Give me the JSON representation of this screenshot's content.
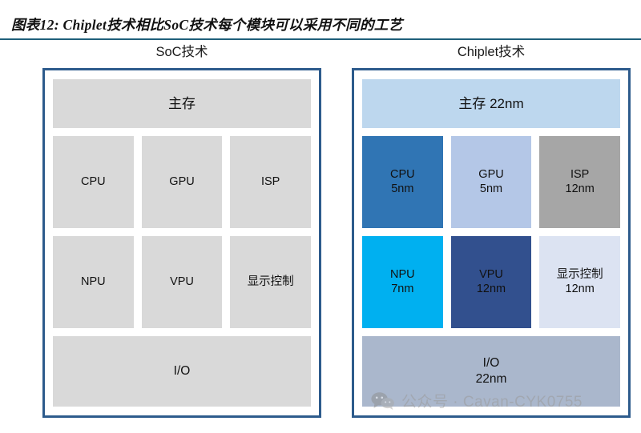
{
  "figure": {
    "title": "图表12: Chiplet技术相比SoC技术每个模块可以采用不同的工艺",
    "rule_color": "#1f5f7a",
    "panel_border_color": "#2d5b8c"
  },
  "panels": [
    {
      "id": "soc",
      "heading": "SoC技术",
      "rows": [
        {
          "id": "memory-row",
          "blocks": [
            {
              "name": "main-memory",
              "label": "主存",
              "sublabel": "",
              "color": "#d9d9d9"
            }
          ]
        },
        {
          "id": "compute-row-1",
          "blocks": [
            {
              "name": "cpu",
              "label": "CPU",
              "sublabel": "",
              "color": "#d9d9d9"
            },
            {
              "name": "gpu",
              "label": "GPU",
              "sublabel": "",
              "color": "#d9d9d9"
            },
            {
              "name": "isp",
              "label": "ISP",
              "sublabel": "",
              "color": "#d9d9d9"
            }
          ]
        },
        {
          "id": "compute-row-2",
          "blocks": [
            {
              "name": "npu",
              "label": "NPU",
              "sublabel": "",
              "color": "#d9d9d9"
            },
            {
              "name": "vpu",
              "label": "VPU",
              "sublabel": "",
              "color": "#d9d9d9"
            },
            {
              "name": "display-controller",
              "label": "显示控制",
              "sublabel": "",
              "color": "#d9d9d9"
            }
          ]
        },
        {
          "id": "io-row",
          "blocks": [
            {
              "name": "io",
              "label": "I/O",
              "sublabel": "",
              "color": "#d9d9d9"
            }
          ]
        }
      ]
    },
    {
      "id": "chiplet",
      "heading": "Chiplet技术",
      "rows": [
        {
          "id": "memory-row",
          "blocks": [
            {
              "name": "main-memory",
              "label": "主存 22nm",
              "sublabel": "",
              "color": "#bdd7ee"
            }
          ]
        },
        {
          "id": "compute-row-1",
          "blocks": [
            {
              "name": "cpu",
              "label": "CPU",
              "sublabel": "5nm",
              "color": "#3075b4"
            },
            {
              "name": "gpu",
              "label": "GPU",
              "sublabel": "5nm",
              "color": "#b4c7e7"
            },
            {
              "name": "isp",
              "label": "ISP",
              "sublabel": "12nm",
              "color": "#a6a6a6"
            }
          ]
        },
        {
          "id": "compute-row-2",
          "blocks": [
            {
              "name": "npu",
              "label": "NPU",
              "sublabel": "7nm",
              "color": "#00b0f0"
            },
            {
              "name": "vpu",
              "label": "VPU",
              "sublabel": "12nm",
              "color": "#32508e"
            },
            {
              "name": "display-controller",
              "label": "显示控制",
              "sublabel": "12nm",
              "color": "#dce3f2"
            }
          ]
        },
        {
          "id": "io-row",
          "blocks": [
            {
              "name": "io",
              "label": "I/O",
              "sublabel": "22nm",
              "color": "#aab7cc"
            }
          ]
        }
      ]
    }
  ],
  "watermark": {
    "icon": "wechat-icon",
    "text": "公众号 · Cavan-CYK0755",
    "color": "#9a9a9a"
  }
}
